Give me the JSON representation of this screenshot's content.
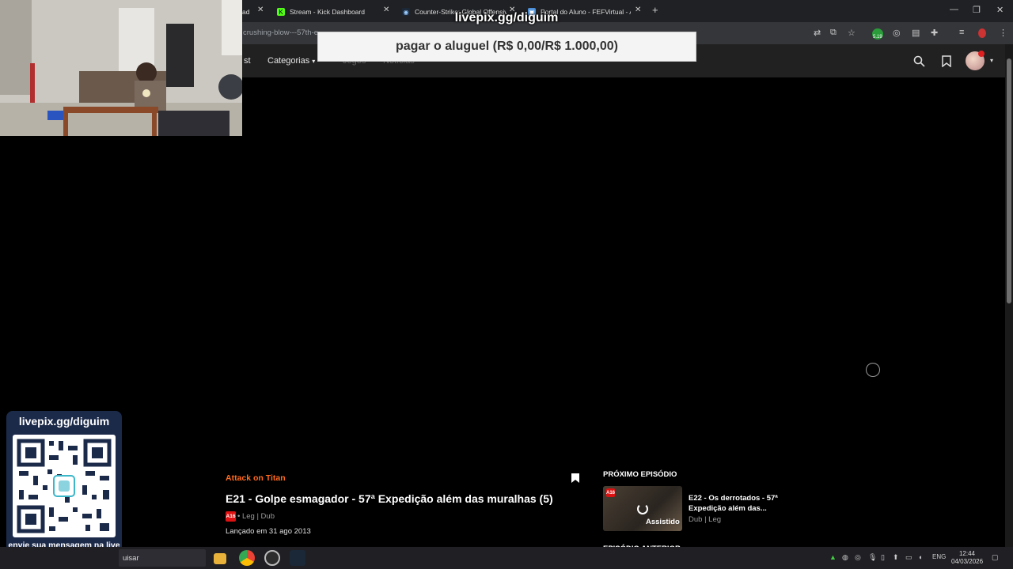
{
  "browser": {
    "tabs": [
      {
        "title": "Stream - Kick Dashboard",
        "icon": "kick-icon"
      },
      {
        "title": "Counter-Strike: Global Offensive",
        "icon": "steam-icon"
      },
      {
        "title": "Portal do Aluno - FEFVirtual - A",
        "icon": "portal-icon"
      }
    ],
    "first_tab_partial": "ad",
    "url": "crushing-blow---57th-e",
    "extension_badge": "5.19"
  },
  "site_nav": {
    "items": [
      "st",
      "Categorias",
      "Jogos",
      "Notícias"
    ]
  },
  "overlay": {
    "donation_title": "livepix.gg/diguim",
    "goal_text": "pagar o aluguel (R$ 0,00/R$ 1.000,00)",
    "qr_title": "livepix.gg/diguim",
    "qr_message": "envie sua mensagem na live via pix!"
  },
  "episode": {
    "series": "Attack on Titan",
    "title": "E21 - Golpe esmagador - 57ª Expedição além das muralhas (5)",
    "rating": "A16",
    "audio": "• Leg | Dub",
    "release": "Lançado em 31 ago 2013"
  },
  "next_episode": {
    "label": "PRÓXIMO EPISÓDIO",
    "rating": "A16",
    "status": "Assistido",
    "title": "E22 - Os derrotados - 57ª Expedição além das...",
    "audio": "Dub | Leg"
  },
  "previous_episode": {
    "label": "EPISÓDIO ANTERIOR"
  },
  "taskbar": {
    "search_text": "uisar",
    "lang": "ENG",
    "time": "12:44",
    "date": "04/03/2026"
  },
  "colors": {
    "accent": "#ff6a1f",
    "nav_bg": "#212121",
    "rating_red": "#dd1111",
    "qr_panel": "#1c2a4a"
  }
}
